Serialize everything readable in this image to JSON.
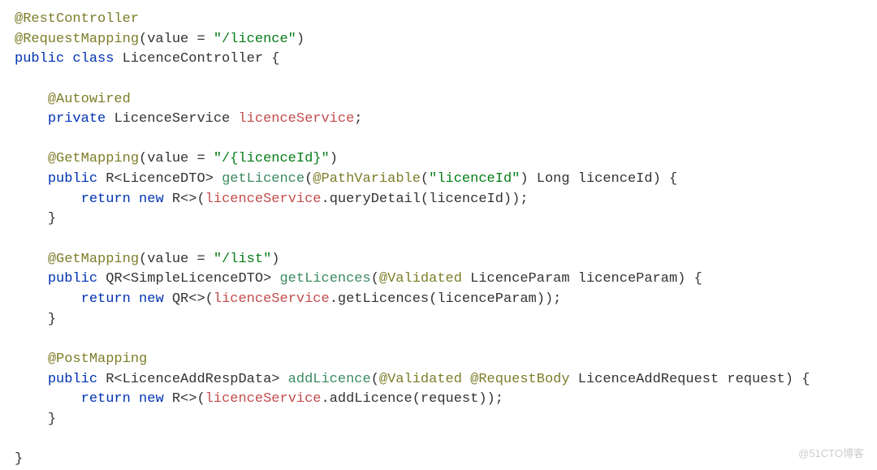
{
  "code": {
    "l1a": "@RestController",
    "l2a": "@RequestMapping",
    "l2p": "(value = ",
    "l2s": "\"/licence\"",
    "l2e": ")",
    "l3a": "public ",
    "l3b": "class ",
    "l3c": "LicenceController {",
    "blank": "",
    "l5a": "@Autowired",
    "l6a": "private ",
    "l6b": "LicenceService ",
    "l6c": "licenceService",
    "l6d": ";",
    "l8a": "@GetMapping",
    "l8p": "(value = ",
    "l8s": "\"/{licenceId}\"",
    "l8e": ")",
    "l9a": "public ",
    "l9b": "R<LicenceDTO> ",
    "l9c": "getLicence",
    "l9d": "(",
    "l9e": "@PathVariable",
    "l9f": "(",
    "l9g": "\"licenceId\"",
    "l9h": ") Long licenceId) {",
    "l10a": "return ",
    "l10b": "new ",
    "l10c": "R<>(",
    "l10d": "licenceService",
    "l10e": ".queryDetail(licenceId));",
    "l11a": "}",
    "l13a": "@GetMapping",
    "l13p": "(value = ",
    "l13s": "\"/list\"",
    "l13e": ")",
    "l14a": "public ",
    "l14b": "QR<SimpleLicenceDTO> ",
    "l14c": "getLicences",
    "l14d": "(",
    "l14e": "@Validated ",
    "l14f": "LicenceParam licenceParam) {",
    "l15a": "return ",
    "l15b": "new ",
    "l15c": "QR<>(",
    "l15d": "licenceService",
    "l15e": ".getLicences(licenceParam));",
    "l16a": "}",
    "l18a": "@PostMapping",
    "l19a": "public ",
    "l19b": "R<LicenceAddRespData> ",
    "l19c": "addLicence",
    "l19d": "(",
    "l19e": "@Validated ",
    "l19f": "@RequestBody ",
    "l19g": "LicenceAddRequest request) {",
    "l20a": "return ",
    "l20b": "new ",
    "l20c": "R<>(",
    "l20d": "licenceService",
    "l20e": ".addLicence(request));",
    "l21a": "}",
    "l23a": "}"
  },
  "indent1": "    ",
  "indent2": "        ",
  "watermark": "@51CTO博客"
}
